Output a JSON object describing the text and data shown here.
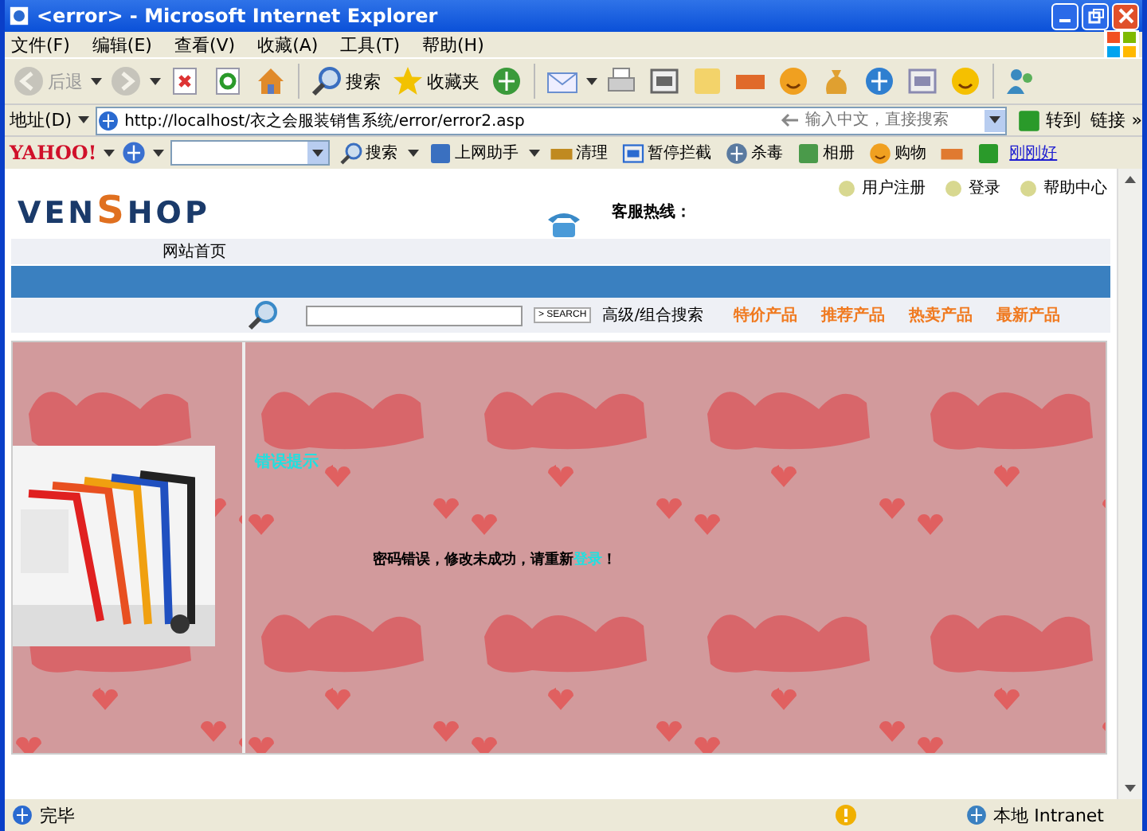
{
  "window": {
    "title": "<error> - Microsoft Internet Explorer"
  },
  "menu": [
    {
      "label": "文件(F)"
    },
    {
      "label": "编辑(E)"
    },
    {
      "label": "查看(V)"
    },
    {
      "label": "收藏(A)"
    },
    {
      "label": "工具(T)"
    },
    {
      "label": "帮助(H)"
    }
  ],
  "toolbar": [
    {
      "label": "后退",
      "disabled": true
    },
    {
      "disabled": true
    },
    {
      "disabled": false
    },
    {
      "disabled": false
    },
    {
      "disabled": false
    },
    {
      "label": "搜索",
      "disabled": false
    },
    {
      "label": "收藏夹",
      "disabled": false
    },
    {
      "disabled": false
    },
    {
      "disabled": false
    },
    {
      "disabled": false
    },
    {
      "disabled": false
    },
    {
      "disabled": false
    },
    {
      "disabled": false
    },
    {
      "disabled": false
    },
    {
      "disabled": false
    },
    {
      "disabled": false
    },
    {
      "disabled": false
    },
    {
      "disabled": false
    },
    {
      "disabled": false
    }
  ],
  "address": {
    "label": "地址(D)",
    "url": "http://localhost/衣之会服装销售系统/error/error2.asp",
    "search_placeholder": "输入中文，直接搜索",
    "go": "转到",
    "links": "链接",
    "more": "»"
  },
  "yahoo_bar": {
    "logo": "YAHOO!",
    "items": [
      {
        "label": "搜索",
        "kind": "button"
      },
      {
        "label": "上网助手",
        "kind": "button"
      },
      {
        "label": "清理",
        "kind": "button"
      },
      {
        "label": "暂停拦截",
        "kind": "button"
      },
      {
        "label": "杀毒",
        "kind": "button"
      },
      {
        "label": "相册",
        "kind": "button"
      },
      {
        "label": "购物",
        "kind": "button"
      },
      {
        "kind": "icon"
      },
      {
        "kind": "icon"
      },
      {
        "label": "刚刚好",
        "kind": "link"
      }
    ]
  },
  "page": {
    "logo": [
      "VEN",
      "S",
      "HOP"
    ],
    "top_links": [
      {
        "label": "用户注册"
      },
      {
        "label": "登录"
      },
      {
        "label": "帮助中心"
      }
    ],
    "hotline": "客服热线：",
    "nav": [
      {
        "label": "网站首页"
      }
    ],
    "search": {
      "button": "> SEARCH",
      "advanced": "高级/组合搜索"
    },
    "categories": [
      {
        "label": "特价产品"
      },
      {
        "label": "推荐产品"
      },
      {
        "label": "热卖产品"
      },
      {
        "label": "最新产品"
      }
    ],
    "error_title": "错误提示",
    "message": {
      "before": "密码错误，修改未成功，请重新",
      "link": "登录",
      "after": "！"
    }
  },
  "status_bar": {
    "text": "完毕",
    "zone": "本地 Intranet"
  }
}
